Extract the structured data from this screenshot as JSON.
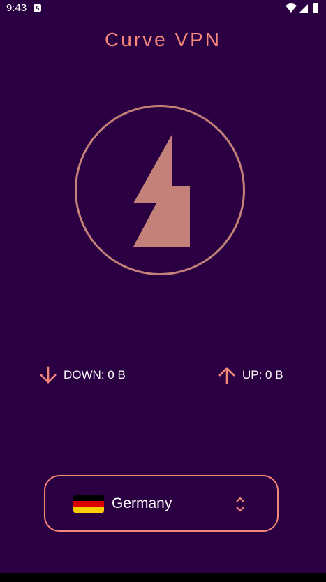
{
  "status_bar": {
    "time": "9:43",
    "notification_icon": "a-icon",
    "icons": [
      "wifi-icon",
      "signal-icon",
      "battery-icon"
    ]
  },
  "app": {
    "title": "Curve VPN",
    "accent_color": "#f4857a",
    "background_color": "#2a0042",
    "power_color": "#c4817a"
  },
  "power_button": {
    "icon": "lightning-bolt-icon"
  },
  "traffic": {
    "down_label": "DOWN: 0 B",
    "down_icon": "arrow-down-icon",
    "up_label": "UP: 0 B",
    "up_icon": "arrow-up-icon"
  },
  "server": {
    "country": "Germany",
    "flag_icon": "germany-flag-icon",
    "selector_icon": "unfold-icon"
  }
}
